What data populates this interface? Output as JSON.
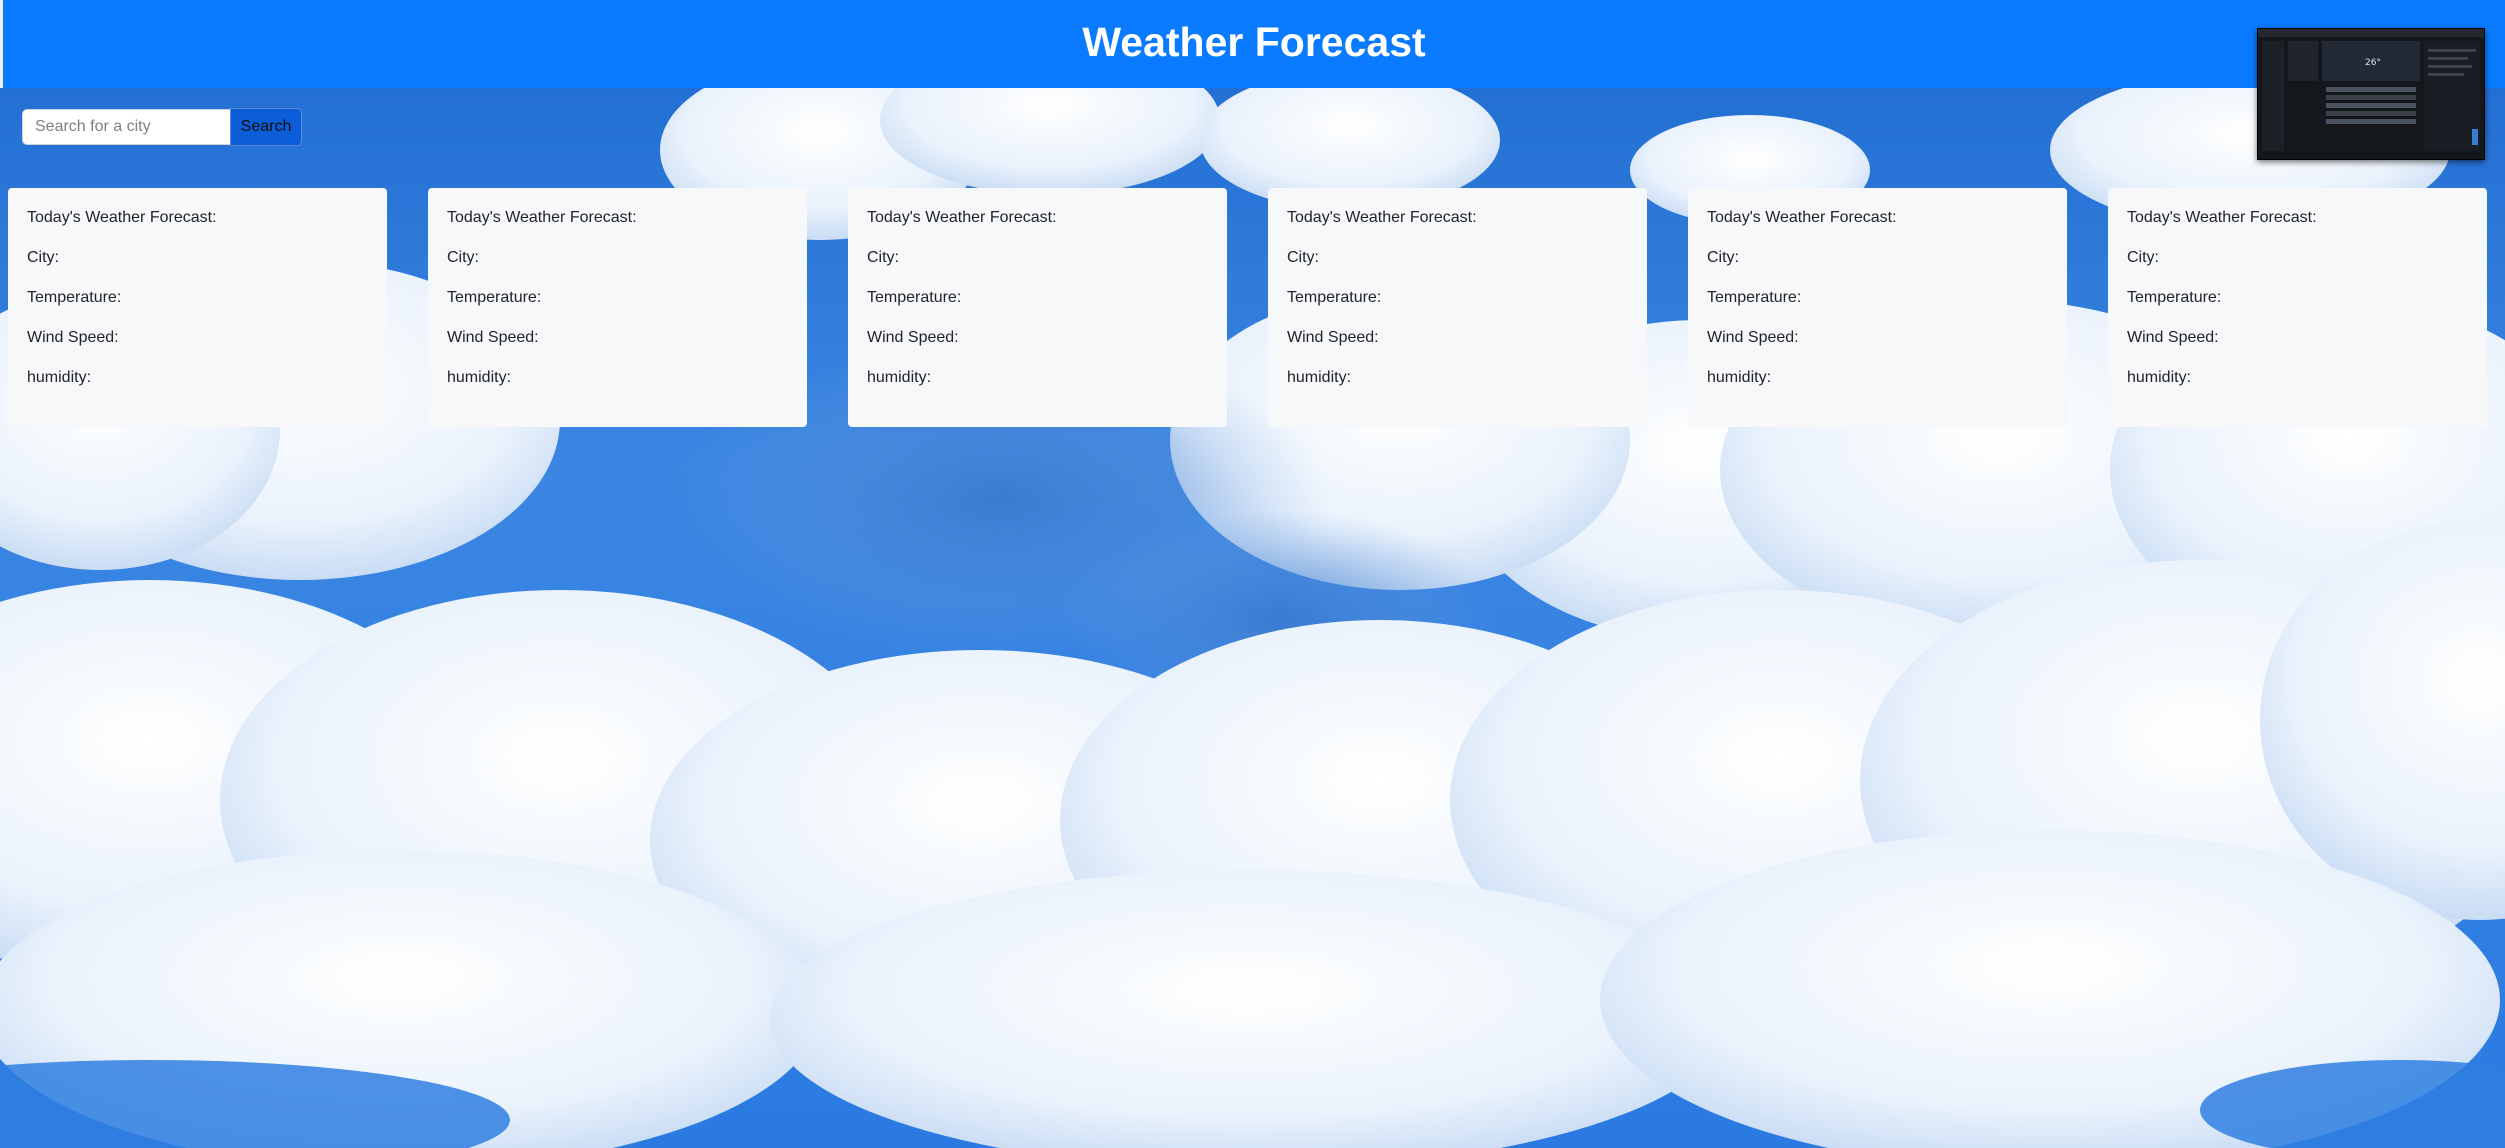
{
  "header": {
    "title": "Weather Forecast"
  },
  "search": {
    "placeholder": "Search for a city",
    "value": "",
    "button_label": "Search"
  },
  "cards": [
    {
      "heading": "Today's Weather Forecast:",
      "city_label": "City:",
      "temp_label": "Temperature:",
      "wind_label": "Wind Speed:",
      "humidity_label": "humidity:"
    },
    {
      "heading": "Today's Weather Forecast:",
      "city_label": "City:",
      "temp_label": "Temperature:",
      "wind_label": "Wind Speed:",
      "humidity_label": "humidity:"
    },
    {
      "heading": "Today's Weather Forecast:",
      "city_label": "City:",
      "temp_label": "Temperature:",
      "wind_label": "Wind Speed:",
      "humidity_label": "humidity:"
    },
    {
      "heading": "Today's Weather Forecast:",
      "city_label": "City:",
      "temp_label": "Temperature:",
      "wind_label": "Wind Speed:",
      "humidity_label": "humidity:"
    },
    {
      "heading": "Today's Weather Forecast:",
      "city_label": "City:",
      "temp_label": "Temperature:",
      "wind_label": "Wind Speed:",
      "humidity_label": "humidity:"
    },
    {
      "heading": "Today's Weather Forecast:",
      "city_label": "City:",
      "temp_label": "Temperature:",
      "wind_label": "Wind Speed:",
      "humidity_label": "humidity:"
    }
  ],
  "colors": {
    "header_bg": "#0a7bff",
    "button_bg": "#0b5ed7",
    "card_bg": "#f7f8fa",
    "sky_blue": "#2f7fe0"
  },
  "icons": {
    "background": "cloudy-sky-image",
    "thumbnail": "screenshot-preview-thumbnail"
  }
}
